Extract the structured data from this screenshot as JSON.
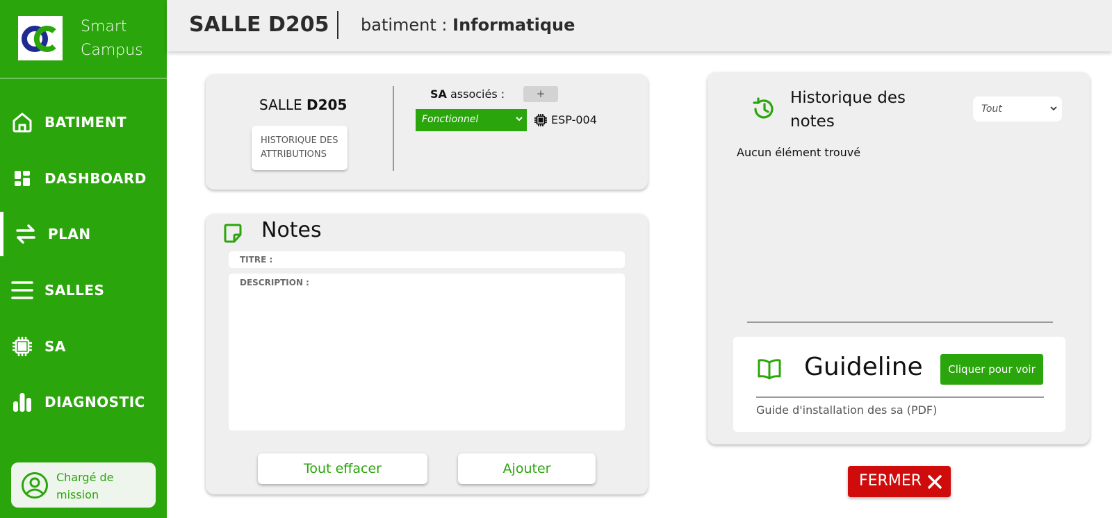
{
  "app": {
    "brand_line1": "Smart",
    "brand_line2": "Campus",
    "accent_color": "#2ba50c",
    "danger_color": "#cf0b0b"
  },
  "sidebar": {
    "items": [
      {
        "label": "BATIMENT",
        "icon": "home-icon"
      },
      {
        "label": "DASHBOARD",
        "icon": "dashboard-icon"
      },
      {
        "label": "PLAN",
        "icon": "swap-arrows-icon",
        "active": true
      },
      {
        "label": "SALLES",
        "icon": "menu-lines-icon"
      },
      {
        "label": "SA",
        "icon": "chip-icon"
      },
      {
        "label": "DIAGNOSTIC",
        "icon": "bar-chart-icon"
      }
    ],
    "user": {
      "line1": "Chargé de",
      "line2": "mission",
      "icon": "user-circle-icon"
    }
  },
  "header": {
    "title": "SALLE D205",
    "building_prefix": "batiment : ",
    "building_name": "Informatique"
  },
  "room": {
    "label_prefix": "SALLE ",
    "label_code": "D205",
    "history_button_line1": "HISTORIQUE DES",
    "history_button_line2": "ATTRIBUTIONS",
    "sa_bold": "SA",
    "sa_rest": " associés :",
    "add_button": "+",
    "status_value": "Fonctionnel",
    "device_name": "ESP-004"
  },
  "notes": {
    "title": "Notes",
    "titre_placeholder": "TITRE :",
    "description_placeholder": "DESCRIPTION :",
    "clear_button": "Tout effacer",
    "add_button": "Ajouter"
  },
  "history": {
    "title_line1": "Historique des",
    "title_line2": "notes",
    "filter_value": "Tout",
    "empty_text": "Aucun élément trouvé"
  },
  "guideline": {
    "title": "Guideline",
    "button": "Cliquer pour voir",
    "subtitle": "Guide d'installation des sa (PDF)"
  },
  "close_button": "FERMER"
}
